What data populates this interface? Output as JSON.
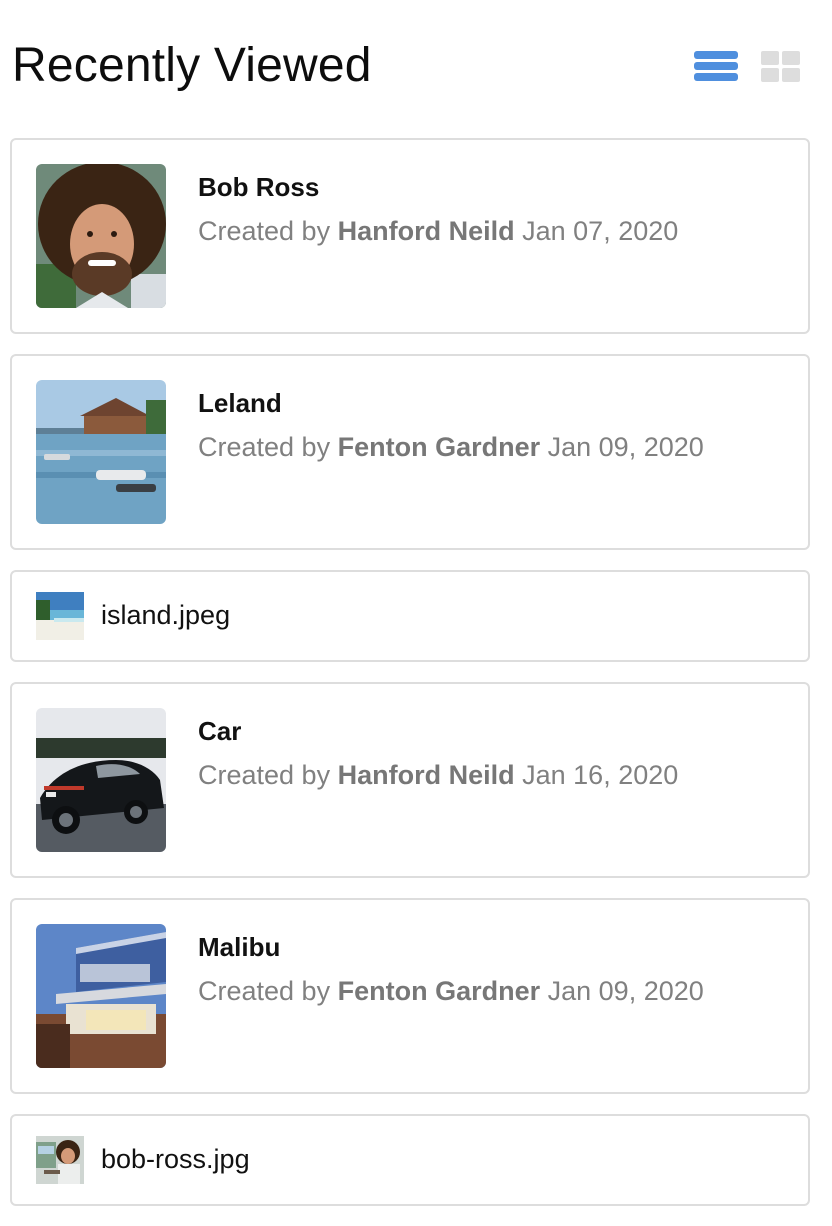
{
  "header": {
    "title": "Recently Viewed",
    "list_view_icon": "list-view-icon",
    "grid_view_icon": "grid-view-icon",
    "active_view": "list",
    "accent_color": "#4f8fde",
    "inactive_color": "#dddddd"
  },
  "items": [
    {
      "kind": "project",
      "title": "Bob Ross",
      "created_prefix": "Created by",
      "author": "Hanford Neild",
      "date": "Jan 07, 2020",
      "thumbnail": "bob-ross-portrait-thumbnail"
    },
    {
      "kind": "project",
      "title": "Leland",
      "created_prefix": "Created by",
      "author": "Fenton Gardner",
      "date": "Jan 09, 2020",
      "thumbnail": "harbor-thumbnail"
    },
    {
      "kind": "file",
      "name": "island.jpeg",
      "thumbnail": "beach-thumbnail"
    },
    {
      "kind": "project",
      "title": "Car",
      "created_prefix": "Created by",
      "author": "Hanford Neild",
      "date": "Jan 16, 2020",
      "thumbnail": "car-thumbnail"
    },
    {
      "kind": "project",
      "title": "Malibu",
      "created_prefix": "Created by",
      "author": "Fenton Gardner",
      "date": "Jan 09, 2020",
      "thumbnail": "modern-house-thumbnail"
    },
    {
      "kind": "file",
      "name": "bob-ross.jpg",
      "thumbnail": "bob-ross-painting-thumbnail"
    }
  ]
}
